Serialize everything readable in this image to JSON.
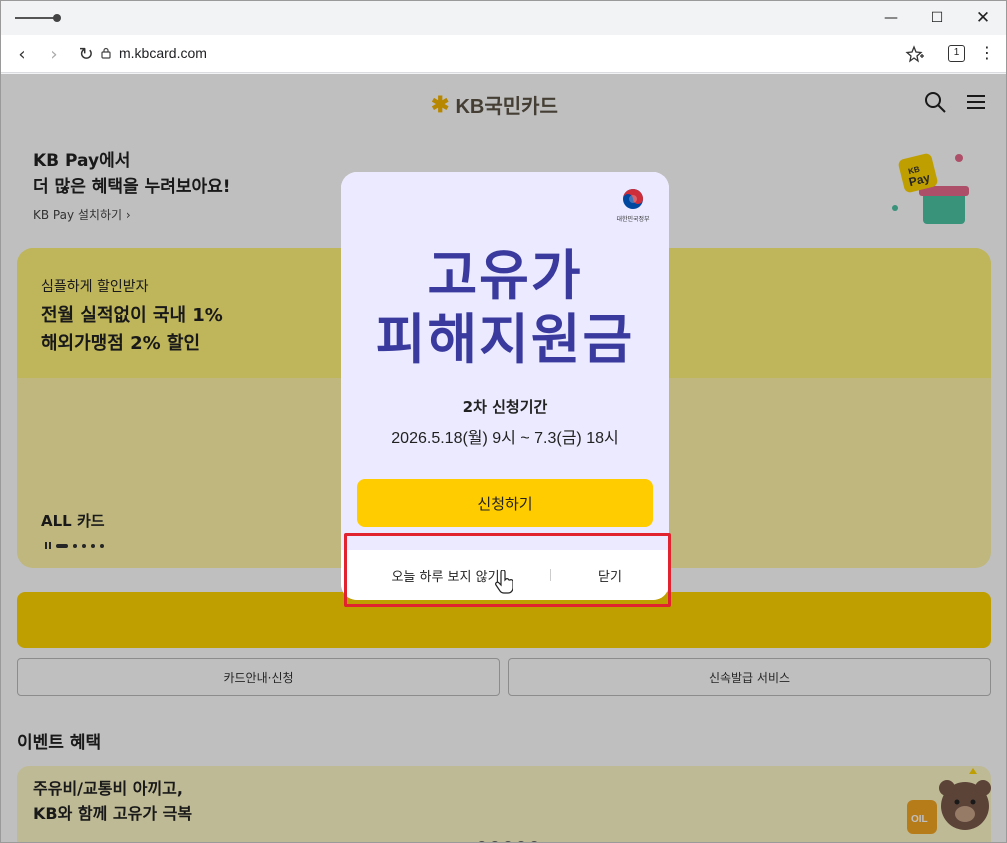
{
  "browser": {
    "url": "m.kbcard.com",
    "tab_count": "1"
  },
  "header": {
    "logo_text": "KB국민카드"
  },
  "promo": {
    "title_line1": "KB Pay에서",
    "title_line2": "더 많은 혜택을 누려보아요!",
    "link": "KB Pay 설치하기 ›",
    "badge_line1": "KB",
    "badge_line2": "Pay"
  },
  "banner": {
    "subtitle": "심플하게 할인받자",
    "title_line1": "전월 실적없이 국내 1%",
    "title_line2": "해외가맹점 2% 할인",
    "card_name": "ALL 카드"
  },
  "buttons": {
    "card_guide": "카드안내·신청",
    "fast_issue": "신속발급 서비스"
  },
  "events": {
    "section_title": "이벤트 혜택",
    "card_title_line1": "주유비/교통비 아끼고,",
    "card_title_line2": "KB와 함께 고유가 극복",
    "oil_label": "OIL"
  },
  "modal": {
    "gov_label": "대한민국정부",
    "headline_line1": "고유가",
    "headline_line2": "피해지원금",
    "period_label": "2차 신청기간",
    "period_dates": "2026.5.18(월) 9시 ~ 7.3(금) 18시",
    "apply_label": "신청하기",
    "dont_show_today": "오늘 하루 보지 않기",
    "close_label": "닫기"
  },
  "colors": {
    "accent_yellow": "#ffcc00",
    "headline_blue": "#3a3a9e",
    "highlight_red": "#e0232e"
  }
}
